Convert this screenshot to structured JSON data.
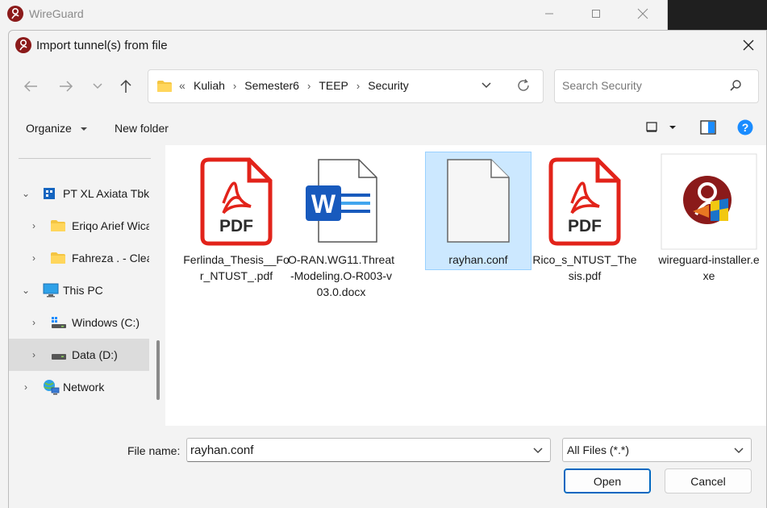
{
  "background_window": {
    "title": "WireGuard"
  },
  "dialog": {
    "title": "Import tunnel(s) from file",
    "close_label": "✕"
  },
  "address": {
    "overflow": "«",
    "crumbs": [
      "Kuliah",
      "Semester6",
      "TEEP",
      "Security"
    ]
  },
  "search": {
    "placeholder": "Search Security"
  },
  "toolbar": {
    "organize_label": "Organize",
    "new_folder_label": "New folder"
  },
  "nav": {
    "items": [
      {
        "label": "PT XL Axiata Tbk"
      },
      {
        "label": "Eriqo Arief Wicaksono"
      },
      {
        "label": "Fahreza . - Clear"
      },
      {
        "label": "This PC"
      },
      {
        "label": "Windows (C:)"
      },
      {
        "label": "Data (D:)"
      },
      {
        "label": "Network"
      }
    ]
  },
  "files": [
    {
      "name": "Ferlinda_Thesis__For_NTUST_.pdf",
      "type": "pdf",
      "badge": "PDF"
    },
    {
      "name": "O-RAN.WG11.Threat-Modeling.O-R003-v03.0.docx",
      "type": "docx",
      "badge": "W"
    },
    {
      "name": "rayhan.conf",
      "type": "blank",
      "selected": true
    },
    {
      "name": "Rico_s_NTUST_Thesis.pdf",
      "type": "pdf",
      "badge": "PDF"
    },
    {
      "name": "wireguard-installer.exe",
      "type": "exe"
    }
  ],
  "bottom": {
    "file_name_label": "File name:",
    "file_name_value": "rayhan.conf",
    "file_type_value": "All Files (*.*)",
    "open_label": "Open",
    "cancel_label": "Cancel"
  },
  "colors": {
    "pdf_red": "#e2231a",
    "word_blue": "#185abd",
    "selection": "#cce8ff",
    "accent": "#0067c0",
    "folder": "#f4c542",
    "help_blue": "#1a8cff"
  }
}
